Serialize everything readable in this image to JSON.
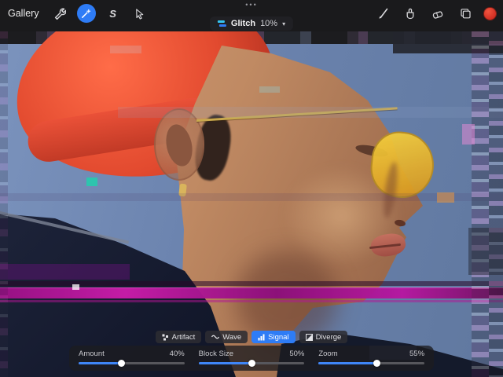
{
  "header": {
    "gallery_label": "Gallery",
    "ellipsis": "•••",
    "icons": {
      "left": [
        "wrench-icon",
        "adjustments-icon",
        "selection-icon",
        "transform-icon"
      ],
      "right": [
        "brush-icon",
        "smudge-icon",
        "eraser-icon",
        "layers-icon",
        "color-swatch"
      ],
      "selection_glyph": "S",
      "active_tool": "adjustments"
    }
  },
  "filter_bar": {
    "name": "Glitch",
    "value": "10%",
    "chevron": "▾"
  },
  "panel": {
    "tabs": [
      {
        "label": "Artifact",
        "selected": false
      },
      {
        "label": "Wave",
        "selected": false
      },
      {
        "label": "Signal",
        "selected": true
      },
      {
        "label": "Diverge",
        "selected": false
      }
    ],
    "sliders": [
      {
        "label": "Amount",
        "value": "40%",
        "percent": 40
      },
      {
        "label": "Block Size",
        "value": "50%",
        "percent": 50
      },
      {
        "label": "Zoom",
        "value": "55%",
        "percent": 55
      }
    ]
  },
  "colors": {
    "accent": "#2e7cf6",
    "color_swatch": "#e03a2e",
    "magenta_stripe": "#b5159a",
    "canvas_background": "#6a82ad"
  }
}
